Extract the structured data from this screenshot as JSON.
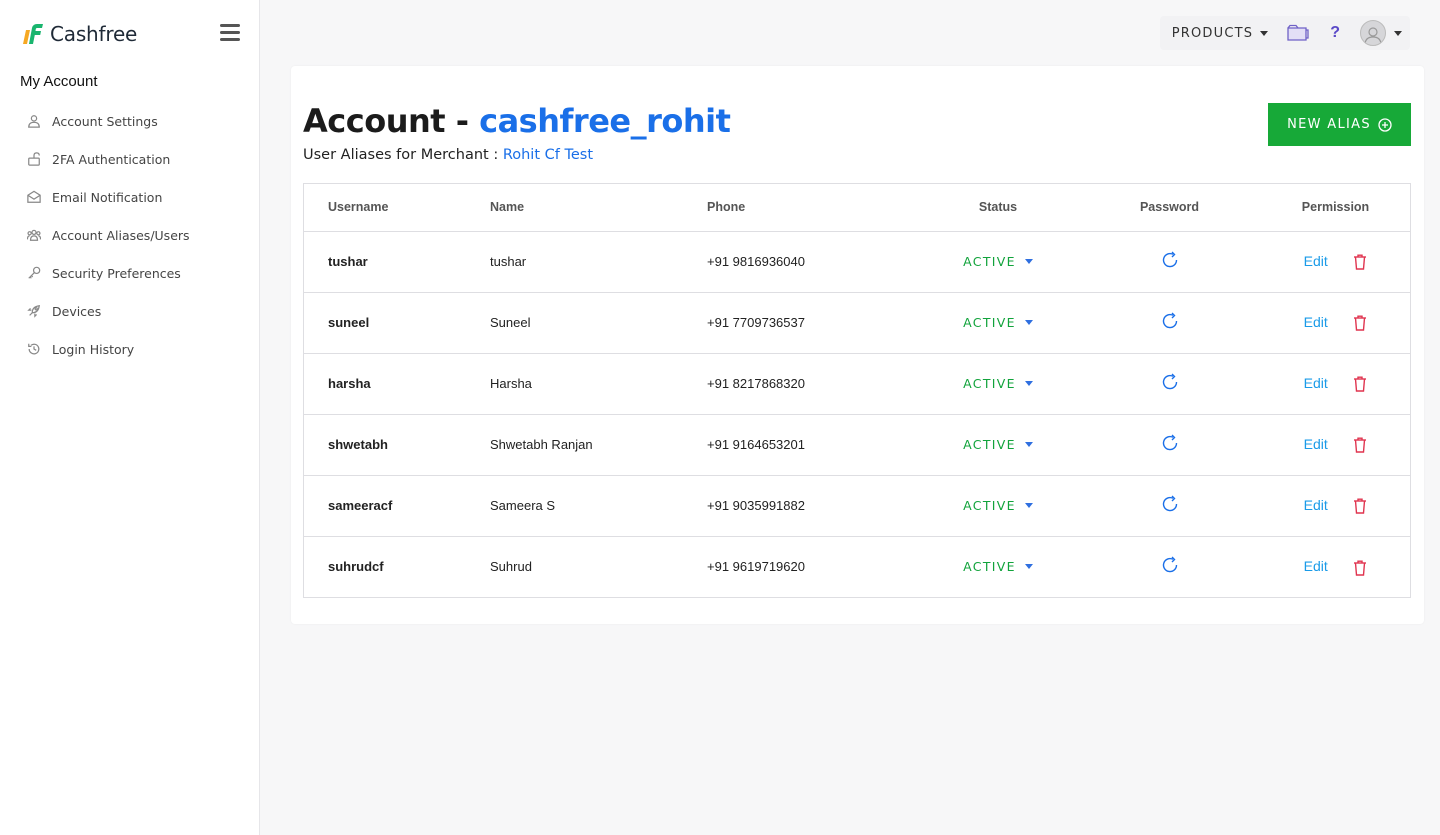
{
  "brand": {
    "name": "Cashfree"
  },
  "sidebar": {
    "heading": "My Account",
    "items": [
      {
        "label": "Account Settings",
        "icon": "user-icon"
      },
      {
        "label": "2FA Authentication",
        "icon": "unlock-icon"
      },
      {
        "label": "Email Notification",
        "icon": "mail-icon"
      },
      {
        "label": "Account Aliases/Users",
        "icon": "users-icon"
      },
      {
        "label": "Security Preferences",
        "icon": "key-icon"
      },
      {
        "label": "Devices",
        "icon": "rocket-icon"
      },
      {
        "label": "Login History",
        "icon": "history-icon"
      }
    ]
  },
  "topbar": {
    "products_label": "PRODUCTS",
    "help_label": "?"
  },
  "header": {
    "title_prefix": "Account - ",
    "account_name": "cashfree_rohit",
    "subtitle_prefix": "User Aliases for Merchant : ",
    "merchant_name": "Rohit Cf Test",
    "new_alias_label": "NEW ALIAS"
  },
  "table": {
    "columns": [
      "Username",
      "Name",
      "Phone",
      "Status",
      "Password",
      "Permission"
    ],
    "rows": [
      {
        "username": "tushar",
        "name": "tushar",
        "phone": "+91 9816936040",
        "status": "ACTIVE",
        "edit": "Edit"
      },
      {
        "username": "suneel",
        "name": "Suneel",
        "phone": "+91 7709736537",
        "status": "ACTIVE",
        "edit": "Edit"
      },
      {
        "username": "harsha",
        "name": "Harsha",
        "phone": "+91 8217868320",
        "status": "ACTIVE",
        "edit": "Edit"
      },
      {
        "username": "shwetabh",
        "name": "Shwetabh Ranjan",
        "phone": "+91 9164653201",
        "status": "ACTIVE",
        "edit": "Edit"
      },
      {
        "username": "sameeracf",
        "name": "Sameera S",
        "phone": "+91 9035991882",
        "status": "ACTIVE",
        "edit": "Edit"
      },
      {
        "username": "suhrudcf",
        "name": "Suhrud",
        "phone": "+91 9619719620",
        "status": "ACTIVE",
        "edit": "Edit"
      }
    ]
  },
  "colors": {
    "accent_blue": "#1a6fe8",
    "active_green": "#11a33b",
    "button_green": "#17a938",
    "delete_red": "#e0344f",
    "edit_blue": "#1a9be8"
  }
}
